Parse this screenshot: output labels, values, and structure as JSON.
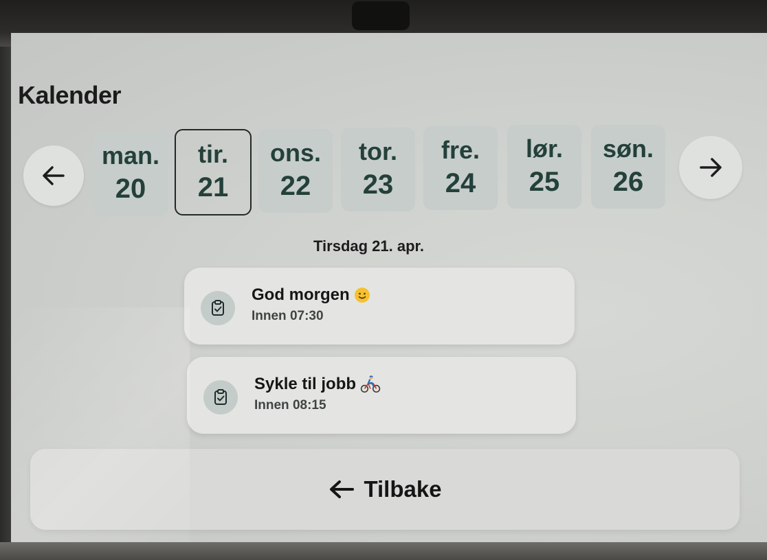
{
  "page": {
    "title": "Kalender"
  },
  "week": {
    "days": [
      {
        "name": "man.",
        "number": "20"
      },
      {
        "name": "tir.",
        "number": "21",
        "selected": true
      },
      {
        "name": "ons.",
        "number": "22"
      },
      {
        "name": "tor.",
        "number": "23"
      },
      {
        "name": "fre.",
        "number": "24"
      },
      {
        "name": "lør.",
        "number": "25"
      },
      {
        "name": "søn.",
        "number": "26"
      }
    ],
    "prev_icon": "arrow-left-icon",
    "next_icon": "arrow-right-icon"
  },
  "selected_date": {
    "heading": "Tirsdag 21. apr."
  },
  "tasks": [
    {
      "title": "God morgen",
      "emoji": "slightly-smiling-face",
      "deadline": "Innen 07:30",
      "icon": "clipboard-check-icon"
    },
    {
      "title": "Sykle til jobb",
      "emoji": "person-biking",
      "deadline": "Innen 08:15",
      "icon": "clipboard-check-icon"
    }
  ],
  "footer": {
    "back_label": "Tilbake",
    "back_icon": "arrow-left-icon"
  },
  "colors": {
    "screen_bg": "#cfd1ce",
    "tile_bg": "#c6cdca",
    "tile_text": "#24403a",
    "card_bg": "#e4e5e2",
    "icon_circle": "#c4ccc9"
  }
}
